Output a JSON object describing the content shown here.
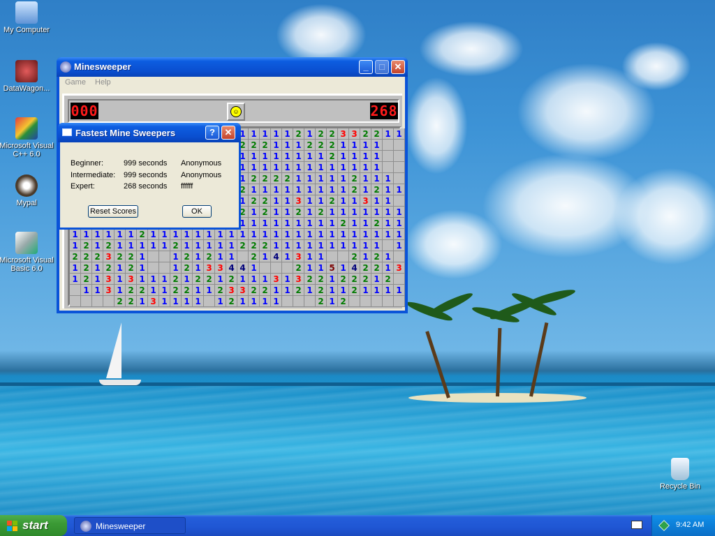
{
  "desktop": {
    "icons": [
      {
        "label": "My Computer",
        "icon": "computer-icon"
      },
      {
        "label": "DataWagon...",
        "icon": "datawagon-icon"
      },
      {
        "label": "Microsoft Visual C++ 6.0",
        "icon": "visual-cpp-icon"
      },
      {
        "label": "Mypal",
        "icon": "mypal-icon"
      },
      {
        "label": "Microsoft Visual Basic 6.0",
        "icon": "visual-basic-icon"
      },
      {
        "label": "Recycle Bin",
        "icon": "recycle-bin-icon"
      }
    ]
  },
  "window": {
    "title": "Minesweeper",
    "menu": [
      "Game",
      "Help"
    ],
    "mine_counter": "000",
    "timer": "268",
    "grid_rows": [
      "112111111111222111112122332211",
      "1121222111222112221112221111  ",
      "1122112211122221111111121111  ",
      "1221113322111211111111111111  ",
      "  111122111122112222111112111 ",
      "  1212111212111211111111121211",
      "  122213311212212211311211311 ",
      "  1111111111211212112121111111",
      "111111211111111111111111211211",
      "111111211111111111111111111111",
      "1212111112111112221111111111 1",
      "2223221  121211 2141311  2121 ",
      "1212121  12133441   21151422131",
      "12131311121221211131322122212 ",
      " 11312211221123322112121121111",
      "    22131111 121111   212     "
    ]
  },
  "dialog": {
    "title": "Fastest Mine Sweepers",
    "rows": [
      {
        "level": "Beginner:",
        "time": "999 seconds",
        "name": "Anonymous"
      },
      {
        "level": "Intermediate:",
        "time": "999 seconds",
        "name": "Anonymous"
      },
      {
        "level": "Expert:",
        "time": "268 seconds",
        "name": "ffffff"
      }
    ],
    "reset_label": "Reset Scores",
    "ok_label": "OK"
  },
  "taskbar": {
    "start_label": "start",
    "items": [
      {
        "label": "Minesweeper"
      }
    ],
    "clock": "9:42 AM"
  }
}
